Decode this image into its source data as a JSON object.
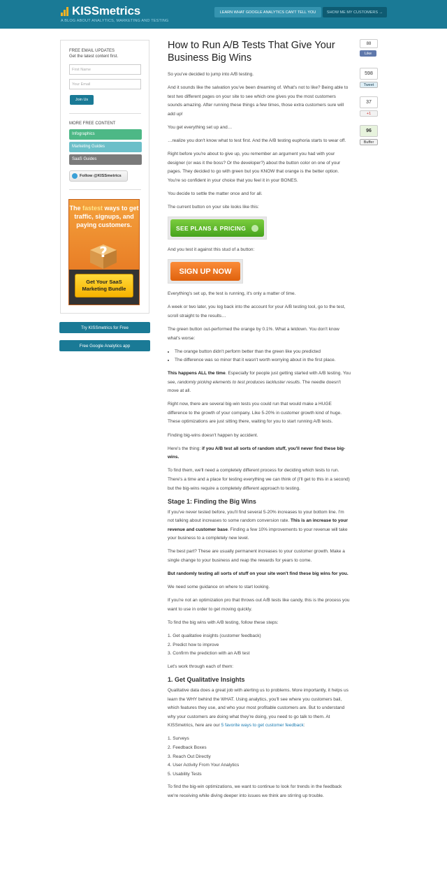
{
  "header": {
    "logo": "KISSmetrics",
    "tagline": "A BLOG ABOUT ANALYTICS, MARKETING AND TESTING",
    "cta1": "LEARN WHAT GOOGLE ANALYTICS CAN'T TELL YOU",
    "cta2": "SHOW ME MY CUSTOMERS →",
    "brand_color": "#1a7a96"
  },
  "sidebar": {
    "email_heading": "FREE EMAIL UPDATES",
    "email_sub": "Get the latest content first.",
    "first_name_placeholder": "First Name",
    "email_placeholder": "Your Email",
    "join_label": "Join Us",
    "more_heading": "MORE FREE CONTENT",
    "content_links": [
      {
        "label": "Infographics",
        "color": "#4db886"
      },
      {
        "label": "Marketing Guides",
        "color": "#6cbfc9"
      },
      {
        "label": "SaaS Guides",
        "color": "#7a7a7a"
      }
    ],
    "follow_label": "Follow @KISSmetrics",
    "ad": {
      "pre": "The ",
      "highlight": "fastest",
      "post": " ways to get traffic, signups, and paying customers.",
      "cta": "Get Your SaaS Marketing Bundle"
    },
    "try_label": "Try KISSmetrics for Free",
    "ga_label": "Free Google Analytics app"
  },
  "share": {
    "likes": "88",
    "like_label": "Like",
    "tweets": "598",
    "tweet_label": "Tweet",
    "gplus": "37",
    "gplus_label": "+1",
    "buffer": "96",
    "buffer_label": "Buffer"
  },
  "article": {
    "title": "How to Run A/B Tests That Give Your Business Big Wins",
    "p1": "So you've decided to jump into A/B testing.",
    "p2": "And it sounds like the salvation you've been dreaming of. What's not to like? Being able to test two different pages on your site to see which one gives you the most customers sounds amazing. After running these things a few times, those extra customers sure will add up!",
    "p3": "You get everything set up and…",
    "p4": "…realize you don't know what to test first. And the A/B testing euphoria starts to wear off.",
    "p5": "Right before you're about to give up, you remember an argument you had with your designer (or was it the boss? Or the developer?) about the button color on one of your pages. They decided to go with green but you KNOW that orange is the better option. You're so confident in your choice that you feel it in your BONES.",
    "p6": "You decide to settle the matter once and for all.",
    "p7": "The current button on your site looks like this:",
    "green_button": "SEE PLANS & PRICING",
    "p8": "And you test it against this stud of a button:",
    "orange_button": "SIGN UP NOW",
    "p9": "Everything's set up, the test is running, it's only a matter of time.",
    "p10": "A week or two later, you log back into the account for your A/B testing tool, go to the test, scroll straight to the results…",
    "p11": "The green button out-performed the orange by 0.1%. What a letdown. You don't know what's worse:",
    "bullets": [
      "The orange button didn't perform better than the green like you predicted",
      "The difference was so minor that it wasn't worth worrying about in the first place."
    ],
    "p12_bold": "This happens ALL the time",
    "p12_rest": ". Especially for people just getting started with A/B testing. You see, ",
    "p12_em": "randomly picking elements to test produces lackluster results",
    "p12_end": ". The needle doesn't move at all.",
    "p13": "Right now, there are several big-win tests you could run that would make a HUGE difference to the growth of your company. Like 5-20% in customer growth kind of huge. These optimizations are just sitting there, waiting for you to start running A/B tests.",
    "p14": "Finding big-wins doesn't happen by accident.",
    "p15_pre": "Here's the thing: ",
    "p15_bold": "if you A/B test all sorts of random stuff, you'll never find these big-wins.",
    "p16": "To find them, we'll need a completely different process for deciding which tests to run. There's a time and a place for testing everything we can think of (I'll get to this in a second) but the big-wins require a completely different approach to testing.",
    "h_stage1": "Stage 1: Finding the Big Wins",
    "p17_pre": "If you've never tested before, you'll find several 5-20% increases to your bottom line. I'm not talking about increases to some random conversion rate. ",
    "p17_bold": "This is an increase to your revenue and customer base",
    "p17_post": ". Finding a few 10% improvements to your revenue will take your business to a completely new level.",
    "p18": "The best part? These are usually permanent increases to your customer growth. Make a single change to your business and reap the rewards for years to come.",
    "p19_bold": "But randomly testing all sorts of stuff on your site won't find these big wins for you.",
    "p20": "We need some guidance on where to start looking.",
    "p21": "If you're not an optimization pro that throws out A/B tests like candy, this is the process you want to use in order to get moving quickly.",
    "p22": "To find the big wins with A/B testing, follow these steps:",
    "steps": [
      "1.  Get qualitative insights (customer feedback)",
      "2.  Predict how to improve",
      "3.  Confirm the prediction with an A/B test"
    ],
    "p23": "Let's work through each of them:",
    "h_qual": "1. Get Qualitative Insights",
    "p24_pre": "Qualitative data does a great job with alerting us to problems. More importantly, it helps us learn the WHY behind the WHAT. Using analytics, you'll see where you customers bail, which features they use, and who your most profitable customers are. But to understand why your customers are doing what they're doing, you need to go talk to them. At KISSmetrics, here are our ",
    "p24_link": "5 favorite ways to get customer feedback",
    "p24_post": ":",
    "methods": [
      "1.  Surveys",
      "2.  Feedback Boxes",
      "3.  Reach Out Directly",
      "4.  User Activity From Your Analytics",
      "5.  Usability Tests"
    ],
    "p25": "To find the big-win optimizations, we want to continue to look for trends in the feedback we're receiving while diving deeper into issues we think are stirring up trouble."
  }
}
